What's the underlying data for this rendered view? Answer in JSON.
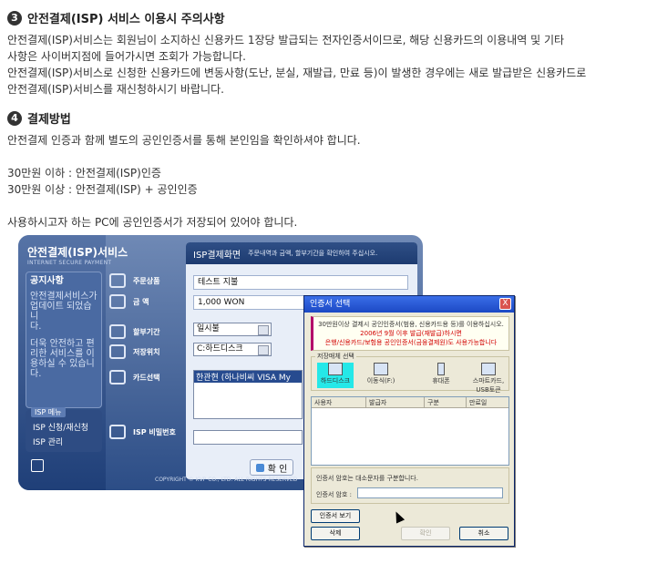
{
  "section1": {
    "number": "3",
    "title": "안전결제(ISP) 서비스 이용시 주의사항",
    "lines": [
      "안전결제(ISP)서비스는 회원님이 소지하신 신용카드 1장당 발급되는 전자인증서이므로, 해당 신용카드의 이용내역 및 기타",
      "사항은 사이버지점에 들어가시면 조회가 가능합니다.",
      "안전결제(ISP)서비스로 신청한 신용카드에 변동사항(도난, 분실, 재발급, 만료 등)이 발생한 경우에는 새로 발급받은 신용카드로",
      "안전결제(ISP)서비스를 재신청하시기 바랍니다."
    ]
  },
  "section2": {
    "number": "4",
    "title": "결제방법",
    "line1": "안전결제 인증과 함께 별도의 공인인증서를 통해 본인임을 확인하셔야 합니다.",
    "line2": "30만원 이하 : 안전결제(ISP)인증",
    "line3": "30만원 이상 : 안전결제(ISP) + 공인인증",
    "line4": "사용하시고자 하는 PC에 공인인증서가 저장되어 있어야 합니다."
  },
  "isp": {
    "brand": "안전결제(ISP)서비스",
    "brand_sub": "INTERNET SECURE PAYMENT",
    "notice_title": "공지사항",
    "notice_lines": [
      "안전결제서비스가",
      "업데이트 되었습니",
      "다.",
      "",
      "더욱 안전하고 편",
      "리한 서비스를 이",
      "용하실 수 있습니",
      "다."
    ],
    "menu_tag": "ISP 메뉴",
    "menu1": "ISP 신청/재신청",
    "menu2": "ISP 관리",
    "labels": [
      "주문상품",
      "금  액",
      "할부기간",
      "저장위치",
      "카드선택",
      "ISP 비밀번호"
    ],
    "header_title": "ISP결제화면",
    "header_sub": "주문내역과 금액, 할부기간을 확인하여 주십시오.",
    "product": "테스트 지불",
    "amount": "1,000  WON",
    "installment": "일시불",
    "storage": "C:하드디스크",
    "card": "한관현 (하나비씨 VISA My",
    "ok": "확 인",
    "copyright": "COPYRIGHT © KVP CO., LTD. ALL RIGHTS RESERVED"
  },
  "dialog": {
    "title": "인증서 선택",
    "close": "X",
    "warn1": "30만원이상 결제시 공인인증서(범용, 신용카드용 등)를 이용하십시오.",
    "warn2": "2006년 9월 이후 발급(재발급)하시면",
    "warn3": "은행/신용카드/보험용 공인인증서(금융결제원)도 사용가능합니다",
    "media_label": "저장매체 선택",
    "media": [
      "하드디스크",
      "이동식(F:)",
      "휴대폰",
      "스마트카드, USB토큰"
    ],
    "columns": [
      "사용자",
      "발급자",
      "구분",
      "만료일"
    ],
    "pw_note": "인증서 암호는 대소문자를 구분합니다.",
    "pw_label": "인증서 암호 :",
    "view_btn": "인증서 보기",
    "delete_btn": "삭제",
    "confirm_btn": "확인",
    "cancel_btn": "취소"
  }
}
